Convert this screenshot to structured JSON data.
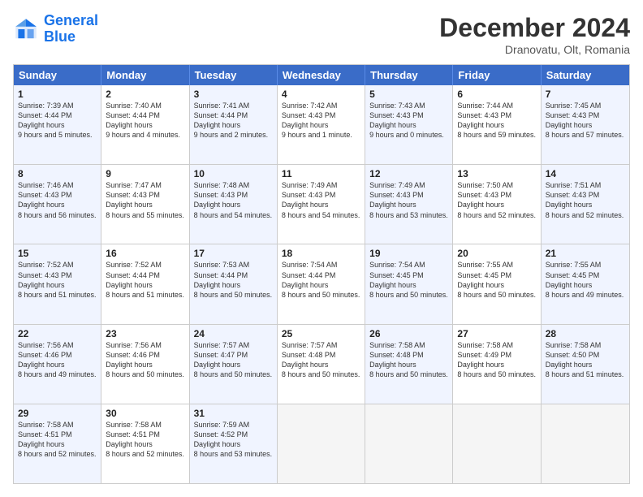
{
  "header": {
    "logo_general": "General",
    "logo_blue": "Blue",
    "title": "December 2024",
    "location": "Dranovatu, Olt, Romania"
  },
  "days_of_week": [
    "Sunday",
    "Monday",
    "Tuesday",
    "Wednesday",
    "Thursday",
    "Friday",
    "Saturday"
  ],
  "weeks": [
    [
      {
        "day": "1",
        "sr": "7:39 AM",
        "ss": "4:44 PM",
        "dl": "9 hours and 5 minutes."
      },
      {
        "day": "2",
        "sr": "7:40 AM",
        "ss": "4:44 PM",
        "dl": "9 hours and 4 minutes."
      },
      {
        "day": "3",
        "sr": "7:41 AM",
        "ss": "4:44 PM",
        "dl": "9 hours and 2 minutes."
      },
      {
        "day": "4",
        "sr": "7:42 AM",
        "ss": "4:43 PM",
        "dl": "9 hours and 1 minute."
      },
      {
        "day": "5",
        "sr": "7:43 AM",
        "ss": "4:43 PM",
        "dl": "9 hours and 0 minutes."
      },
      {
        "day": "6",
        "sr": "7:44 AM",
        "ss": "4:43 PM",
        "dl": "8 hours and 59 minutes."
      },
      {
        "day": "7",
        "sr": "7:45 AM",
        "ss": "4:43 PM",
        "dl": "8 hours and 57 minutes."
      }
    ],
    [
      {
        "day": "8",
        "sr": "7:46 AM",
        "ss": "4:43 PM",
        "dl": "8 hours and 56 minutes."
      },
      {
        "day": "9",
        "sr": "7:47 AM",
        "ss": "4:43 PM",
        "dl": "8 hours and 55 minutes."
      },
      {
        "day": "10",
        "sr": "7:48 AM",
        "ss": "4:43 PM",
        "dl": "8 hours and 54 minutes."
      },
      {
        "day": "11",
        "sr": "7:49 AM",
        "ss": "4:43 PM",
        "dl": "8 hours and 54 minutes."
      },
      {
        "day": "12",
        "sr": "7:49 AM",
        "ss": "4:43 PM",
        "dl": "8 hours and 53 minutes."
      },
      {
        "day": "13",
        "sr": "7:50 AM",
        "ss": "4:43 PM",
        "dl": "8 hours and 52 minutes."
      },
      {
        "day": "14",
        "sr": "7:51 AM",
        "ss": "4:43 PM",
        "dl": "8 hours and 52 minutes."
      }
    ],
    [
      {
        "day": "15",
        "sr": "7:52 AM",
        "ss": "4:43 PM",
        "dl": "8 hours and 51 minutes."
      },
      {
        "day": "16",
        "sr": "7:52 AM",
        "ss": "4:44 PM",
        "dl": "8 hours and 51 minutes."
      },
      {
        "day": "17",
        "sr": "7:53 AM",
        "ss": "4:44 PM",
        "dl": "8 hours and 50 minutes."
      },
      {
        "day": "18",
        "sr": "7:54 AM",
        "ss": "4:44 PM",
        "dl": "8 hours and 50 minutes."
      },
      {
        "day": "19",
        "sr": "7:54 AM",
        "ss": "4:45 PM",
        "dl": "8 hours and 50 minutes."
      },
      {
        "day": "20",
        "sr": "7:55 AM",
        "ss": "4:45 PM",
        "dl": "8 hours and 50 minutes."
      },
      {
        "day": "21",
        "sr": "7:55 AM",
        "ss": "4:45 PM",
        "dl": "8 hours and 49 minutes."
      }
    ],
    [
      {
        "day": "22",
        "sr": "7:56 AM",
        "ss": "4:46 PM",
        "dl": "8 hours and 49 minutes."
      },
      {
        "day": "23",
        "sr": "7:56 AM",
        "ss": "4:46 PM",
        "dl": "8 hours and 50 minutes."
      },
      {
        "day": "24",
        "sr": "7:57 AM",
        "ss": "4:47 PM",
        "dl": "8 hours and 50 minutes."
      },
      {
        "day": "25",
        "sr": "7:57 AM",
        "ss": "4:48 PM",
        "dl": "8 hours and 50 minutes."
      },
      {
        "day": "26",
        "sr": "7:58 AM",
        "ss": "4:48 PM",
        "dl": "8 hours and 50 minutes."
      },
      {
        "day": "27",
        "sr": "7:58 AM",
        "ss": "4:49 PM",
        "dl": "8 hours and 50 minutes."
      },
      {
        "day": "28",
        "sr": "7:58 AM",
        "ss": "4:50 PM",
        "dl": "8 hours and 51 minutes."
      }
    ],
    [
      {
        "day": "29",
        "sr": "7:58 AM",
        "ss": "4:51 PM",
        "dl": "8 hours and 52 minutes."
      },
      {
        "day": "30",
        "sr": "7:58 AM",
        "ss": "4:51 PM",
        "dl": "8 hours and 52 minutes."
      },
      {
        "day": "31",
        "sr": "7:59 AM",
        "ss": "4:52 PM",
        "dl": "8 hours and 53 minutes."
      },
      null,
      null,
      null,
      null
    ]
  ]
}
